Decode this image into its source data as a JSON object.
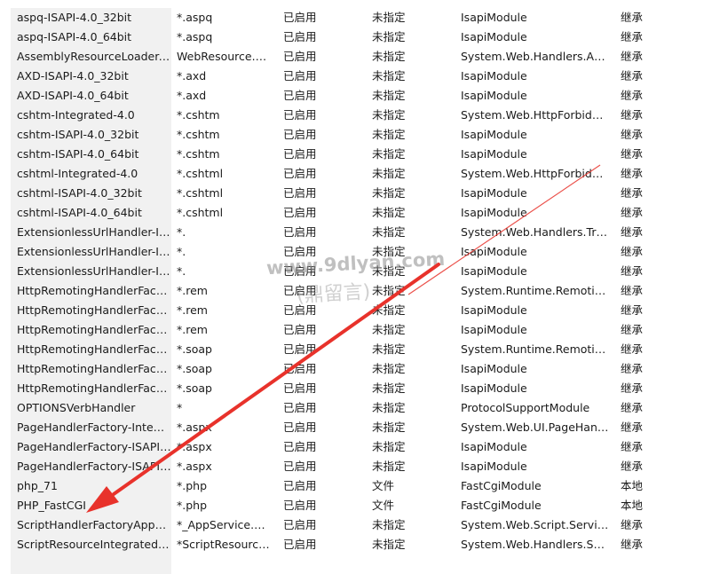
{
  "handler_mappings": {
    "rows": [
      {
        "name": "aspq-ISAPI-4.0_32bit",
        "path": "*.aspq",
        "state": "已启用",
        "verb": "未指定",
        "handler": "IsapiModule",
        "entry": "继承"
      },
      {
        "name": "aspq-ISAPI-4.0_64bit",
        "path": "*.aspq",
        "state": "已启用",
        "verb": "未指定",
        "handler": "IsapiModule",
        "entry": "继承"
      },
      {
        "name": "AssemblyResourceLoader-I...",
        "path": "WebResource.axd",
        "state": "已启用",
        "verb": "未指定",
        "handler": "System.Web.Handlers.Asse...",
        "entry": "继承"
      },
      {
        "name": "AXD-ISAPI-4.0_32bit",
        "path": "*.axd",
        "state": "已启用",
        "verb": "未指定",
        "handler": "IsapiModule",
        "entry": "继承"
      },
      {
        "name": "AXD-ISAPI-4.0_64bit",
        "path": "*.axd",
        "state": "已启用",
        "verb": "未指定",
        "handler": "IsapiModule",
        "entry": "继承"
      },
      {
        "name": "cshtm-Integrated-4.0",
        "path": "*.cshtm",
        "state": "已启用",
        "verb": "未指定",
        "handler": "System.Web.HttpForbidde...",
        "entry": "继承"
      },
      {
        "name": "cshtm-ISAPI-4.0_32bit",
        "path": "*.cshtm",
        "state": "已启用",
        "verb": "未指定",
        "handler": "IsapiModule",
        "entry": "继承"
      },
      {
        "name": "cshtm-ISAPI-4.0_64bit",
        "path": "*.cshtm",
        "state": "已启用",
        "verb": "未指定",
        "handler": "IsapiModule",
        "entry": "继承"
      },
      {
        "name": "cshtml-Integrated-4.0",
        "path": "*.cshtml",
        "state": "已启用",
        "verb": "未指定",
        "handler": "System.Web.HttpForbidde...",
        "entry": "继承"
      },
      {
        "name": "cshtml-ISAPI-4.0_32bit",
        "path": "*.cshtml",
        "state": "已启用",
        "verb": "未指定",
        "handler": "IsapiModule",
        "entry": "继承"
      },
      {
        "name": "cshtml-ISAPI-4.0_64bit",
        "path": "*.cshtml",
        "state": "已启用",
        "verb": "未指定",
        "handler": "IsapiModule",
        "entry": "继承"
      },
      {
        "name": "ExtensionlessUrlHandler-Int...",
        "path": "*.",
        "state": "已启用",
        "verb": "未指定",
        "handler": "System.Web.Handlers.Tran...",
        "entry": "继承"
      },
      {
        "name": "ExtensionlessUrlHandler-IS...",
        "path": "*.",
        "state": "已启用",
        "verb": "未指定",
        "handler": "IsapiModule",
        "entry": "继承"
      },
      {
        "name": "ExtensionlessUrlHandler-IS...",
        "path": "*.",
        "state": "已启用",
        "verb": "未指定",
        "handler": "IsapiModule",
        "entry": "继承"
      },
      {
        "name": "HttpRemotingHandlerFacto...",
        "path": "*.rem",
        "state": "已启用",
        "verb": "未指定",
        "handler": "System.Runtime.Remoting....",
        "entry": "继承"
      },
      {
        "name": "HttpRemotingHandlerFacto...",
        "path": "*.rem",
        "state": "已启用",
        "verb": "未指定",
        "handler": "IsapiModule",
        "entry": "继承"
      },
      {
        "name": "HttpRemotingHandlerFacto...",
        "path": "*.rem",
        "state": "已启用",
        "verb": "未指定",
        "handler": "IsapiModule",
        "entry": "继承"
      },
      {
        "name": "HttpRemotingHandlerFacto...",
        "path": "*.soap",
        "state": "已启用",
        "verb": "未指定",
        "handler": "System.Runtime.Remoting....",
        "entry": "继承"
      },
      {
        "name": "HttpRemotingHandlerFacto...",
        "path": "*.soap",
        "state": "已启用",
        "verb": "未指定",
        "handler": "IsapiModule",
        "entry": "继承"
      },
      {
        "name": "HttpRemotingHandlerFacto...",
        "path": "*.soap",
        "state": "已启用",
        "verb": "未指定",
        "handler": "IsapiModule",
        "entry": "继承"
      },
      {
        "name": "OPTIONSVerbHandler",
        "path": "*",
        "state": "已启用",
        "verb": "未指定",
        "handler": "ProtocolSupportModule",
        "entry": "继承"
      },
      {
        "name": "PageHandlerFactory-Integr...",
        "path": "*.aspx",
        "state": "已启用",
        "verb": "未指定",
        "handler": "System.Web.UI.PageHandl...",
        "entry": "继承"
      },
      {
        "name": "PageHandlerFactory-ISAPI-...",
        "path": "*.aspx",
        "state": "已启用",
        "verb": "未指定",
        "handler": "IsapiModule",
        "entry": "继承"
      },
      {
        "name": "PageHandlerFactory-ISAPI-...",
        "path": "*.aspx",
        "state": "已启用",
        "verb": "未指定",
        "handler": "IsapiModule",
        "entry": "继承"
      },
      {
        "name": "php_71",
        "path": "*.php",
        "state": "已启用",
        "verb": "文件",
        "handler": "FastCgiModule",
        "entry": "本地"
      },
      {
        "name": "PHP_FastCGI",
        "path": "*.php",
        "state": "已启用",
        "verb": "文件",
        "handler": "FastCgiModule",
        "entry": "本地"
      },
      {
        "name": "ScriptHandlerFactoryAppSe...",
        "path": "*_AppService.axd",
        "state": "已启用",
        "verb": "未指定",
        "handler": "System.Web.Script.Services...",
        "entry": "继承"
      },
      {
        "name": "ScriptResourceIntegrated-4.0",
        "path": "*ScriptResource....",
        "state": "已启用",
        "verb": "未指定",
        "handler": "System.Web.Handlers.Scrip...",
        "entry": "继承"
      }
    ]
  },
  "watermark": {
    "line1": "www.9dlyan.com",
    "line2": "(鼎留言)"
  },
  "annotation": {
    "arrow_color": "#e8322b"
  }
}
